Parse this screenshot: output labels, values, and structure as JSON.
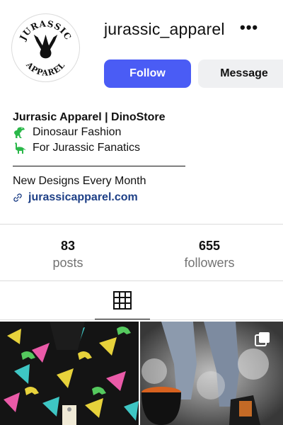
{
  "profile": {
    "username": "jurassic_apparel",
    "avatar_logo": {
      "top_text": "JURASSIC",
      "bottom_text": "APPAREL"
    }
  },
  "actions": {
    "more_label": "•••",
    "follow_label": "Follow",
    "message_label": "Message"
  },
  "bio": {
    "name": "Jurrasic Apparel | DinoStore",
    "lines": [
      {
        "icon": "t-rex-emoji",
        "text": "Dinosaur Fashion"
      },
      {
        "icon": "sauropod-emoji",
        "text": "For Jurassic Fanatics"
      }
    ],
    "designs": "New Designs Every Month",
    "link": "jurassicapparel.com"
  },
  "stats": {
    "posts": {
      "value": "83",
      "label": "posts"
    },
    "followers": {
      "value": "655",
      "label": "followers"
    }
  },
  "tabs": [
    {
      "icon": "grid-icon",
      "active": true
    }
  ],
  "posts": [
    {
      "icon": "dinosaur-print-shirt-photo",
      "multi": false
    },
    {
      "icon": "jeans-boots-smoke-photo",
      "multi": true
    }
  ],
  "colors": {
    "follow_button": "#4a5cf5",
    "message_button": "#eff0f2",
    "link": "#1d3f86",
    "muted_text": "#737373",
    "emoji_green": "#2bb84a"
  }
}
